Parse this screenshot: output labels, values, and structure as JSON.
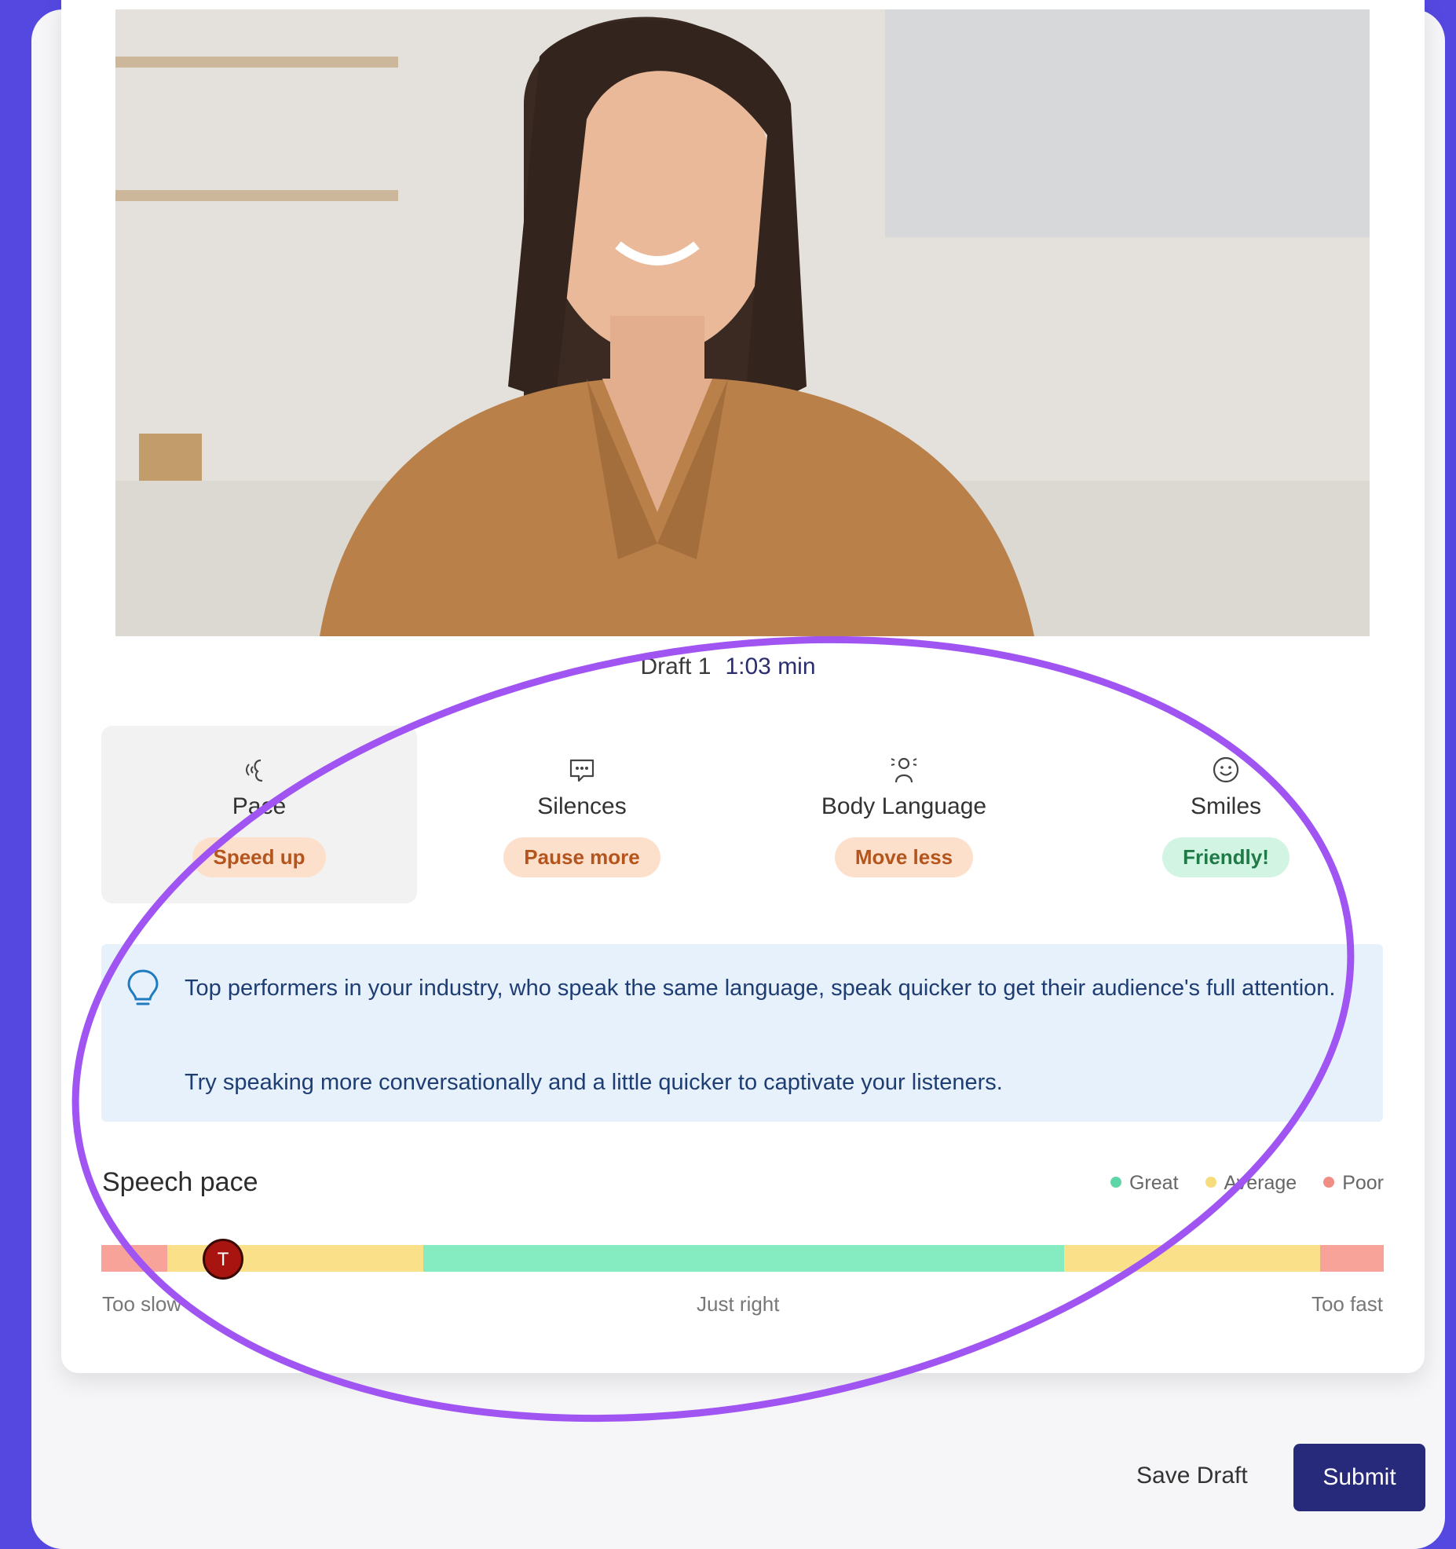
{
  "draft": {
    "label": "Draft 1",
    "duration": "1:03 min"
  },
  "tabs": [
    {
      "label": "Pace",
      "icon": "speech-pace-icon",
      "badge": "Speed up",
      "badge_tone": "orange"
    },
    {
      "label": "Silences",
      "icon": "chat-dots-icon",
      "badge": "Pause more",
      "badge_tone": "orange"
    },
    {
      "label": "Body Language",
      "icon": "person-motion-icon",
      "badge": "Move less",
      "badge_tone": "orange"
    },
    {
      "label": "Smiles",
      "icon": "smile-icon",
      "badge": "Friendly!",
      "badge_tone": "green"
    }
  ],
  "tip": {
    "icon": "lightbulb-icon",
    "line1": "Top performers in your industry, who speak the same language, speak quicker to get their audience's full attention.",
    "line2": "Try speaking more conversationally and a little quicker to captivate your listeners."
  },
  "speech_pace": {
    "title": "Speech pace",
    "legend": [
      {
        "label": "Great",
        "color": "#5fd6a7"
      },
      {
        "label": "Average",
        "color": "#f7dc7e"
      },
      {
        "label": "Poor",
        "color": "#f08e86"
      }
    ],
    "marker_label": "T",
    "marker_position": 0.095,
    "axis": {
      "left": "Too slow",
      "center": "Just right",
      "right": "Too fast"
    }
  },
  "actions": {
    "save_draft": "Save Draft",
    "submit": "Submit"
  }
}
